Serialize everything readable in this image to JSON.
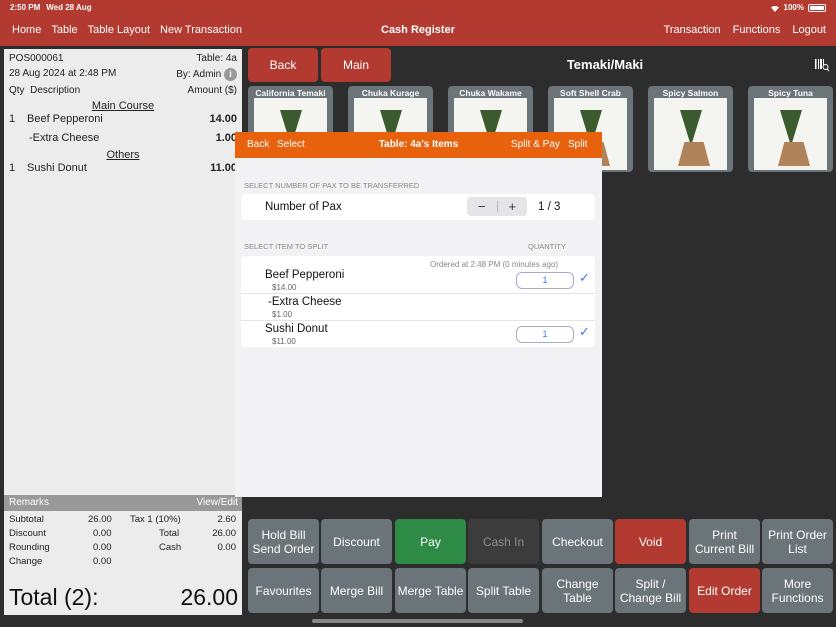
{
  "statusbar": {
    "time": "2:50 PM",
    "date": "Wed 28 Aug",
    "battery": "100%"
  },
  "nav": {
    "left": [
      "Home",
      "Table",
      "Table Layout",
      "New Transaction"
    ],
    "title": "Cash Register",
    "right": [
      "Transaction",
      "Functions",
      "Logout"
    ]
  },
  "receipt": {
    "bill_no": "POS000061",
    "table": "Table: 4a",
    "datetime": "28 Aug 2024 at 2:48 PM",
    "by": "By: Admin",
    "col_qty": "Qty",
    "col_desc": "Description",
    "col_amount": "Amount ($)",
    "section1": "Main Course",
    "item1_qty": "1",
    "item1_name": "Beef Pepperoni",
    "item1_amount": "14.00",
    "item1_mod": "-Extra Cheese",
    "item1_mod_amount": "1.00",
    "section2": "Others",
    "item2_qty": "1",
    "item2_name": "Sushi Donut",
    "item2_amount": "11.00",
    "remarks": "Remarks",
    "view_edit": "View/Edit",
    "subtotal_label": "Subtotal",
    "subtotal": "26.00",
    "tax_label": "Tax 1 (10%)",
    "tax": "2.60",
    "discount_label": "Discount",
    "discount": "0.00",
    "total_label": "Total",
    "total": "26.00",
    "rounding_label": "Rounding",
    "rounding": "0.00",
    "cash_label": "Cash",
    "cash": "0.00",
    "change_label": "Change",
    "change": "0.00",
    "grand_label": "Total (2):",
    "grand_amount": "26.00"
  },
  "top": {
    "back": "Back",
    "main": "Main",
    "category": "Temaki/Maki"
  },
  "menu": [
    "California Temaki",
    "Chuka Kurage",
    "Chuka Wakame",
    "Soft Shell Crab",
    "Spicy Salmon",
    "Spicy Tuna"
  ],
  "functions": {
    "hold": "Hold Bill Send Order",
    "discount": "Discount",
    "pay": "Pay",
    "cashin": "Cash In",
    "checkout": "Checkout",
    "void": "Void",
    "print_bill": "Print Current Bill",
    "print_list": "Print Order List",
    "favourites": "Favourites",
    "merge_bill": "Merge Bill",
    "merge_table": "Merge Table",
    "split_table": "Split Table",
    "change_table": "Change Table",
    "split_change": "Split / Change Bill",
    "edit_order": "Edit Order",
    "more": "More Functions"
  },
  "modal": {
    "back": "Back",
    "select": "Select",
    "title": "Table: 4a's Items",
    "split_pay": "Split & Pay",
    "split": "Split",
    "pax_caption": "SELECT NUMBER OF PAX TO BE TRANSFERRED",
    "pax_label": "Number of Pax",
    "pax_value": "1 / 3",
    "item_caption": "SELECT ITEM TO SPLIT",
    "qty_caption": "QUANTITY",
    "ordered_at": "Ordered at 2:48 PM (0 minutes ago)",
    "items": [
      {
        "name": "Beef Pepperoni",
        "price": "$14.00",
        "qty": "1"
      },
      {
        "name": "-Extra Cheese",
        "price": "$1.00"
      },
      {
        "name": "Sushi Donut",
        "price": "$11.00",
        "qty": "1"
      }
    ]
  }
}
